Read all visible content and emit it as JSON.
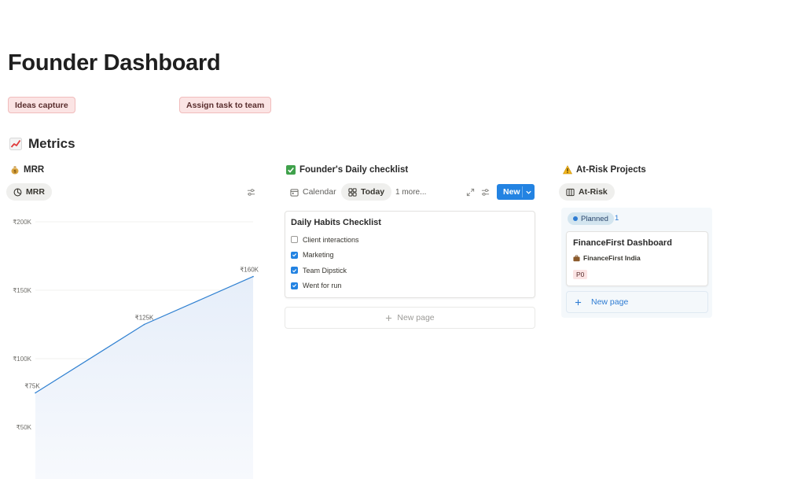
{
  "page": {
    "title": "Founder Dashboard"
  },
  "buttons": {
    "ideas_capture": "Ideas capture",
    "assign_task": "Assign task to team"
  },
  "metrics": {
    "heading": "Metrics"
  },
  "mrr": {
    "title": "MRR",
    "view_label": "MRR"
  },
  "checklist": {
    "title": "Founder's Daily checklist",
    "views": {
      "calendar": "Calendar",
      "today": "Today",
      "more": "1 more..."
    },
    "new_label": "New",
    "card": {
      "title": "Daily Habits Checklist",
      "items": [
        {
          "label": "Client interactions",
          "checked": false
        },
        {
          "label": "Marketing",
          "checked": true
        },
        {
          "label": "Team Dipstick",
          "checked": true
        },
        {
          "label": "Went for run",
          "checked": true
        }
      ]
    },
    "new_page_label": "New page"
  },
  "at_risk": {
    "title": "At-Risk Projects",
    "view_label": "At-Risk",
    "group": {
      "label": "Planned",
      "count": "1"
    },
    "card": {
      "title": "FinanceFirst Dashboard",
      "client": "FinanceFirst India",
      "priority": "P0"
    },
    "new_page_label": "New page"
  },
  "chart_data": {
    "type": "area",
    "x": [
      1,
      2,
      3
    ],
    "values": [
      75000,
      125000,
      160000
    ],
    "data_labels": [
      "₹75K",
      "₹125K",
      "₹160K"
    ],
    "y_ticks": [
      50000,
      100000,
      150000,
      200000
    ],
    "y_tick_labels": [
      "₹50K",
      "₹100K",
      "₹150K",
      "₹200K"
    ],
    "ylim": [
      30000,
      200000
    ],
    "grid": true,
    "color": "#2f80d1"
  },
  "colors": {
    "accent": "#2383e2",
    "pink_button": "#fbe4e4"
  }
}
